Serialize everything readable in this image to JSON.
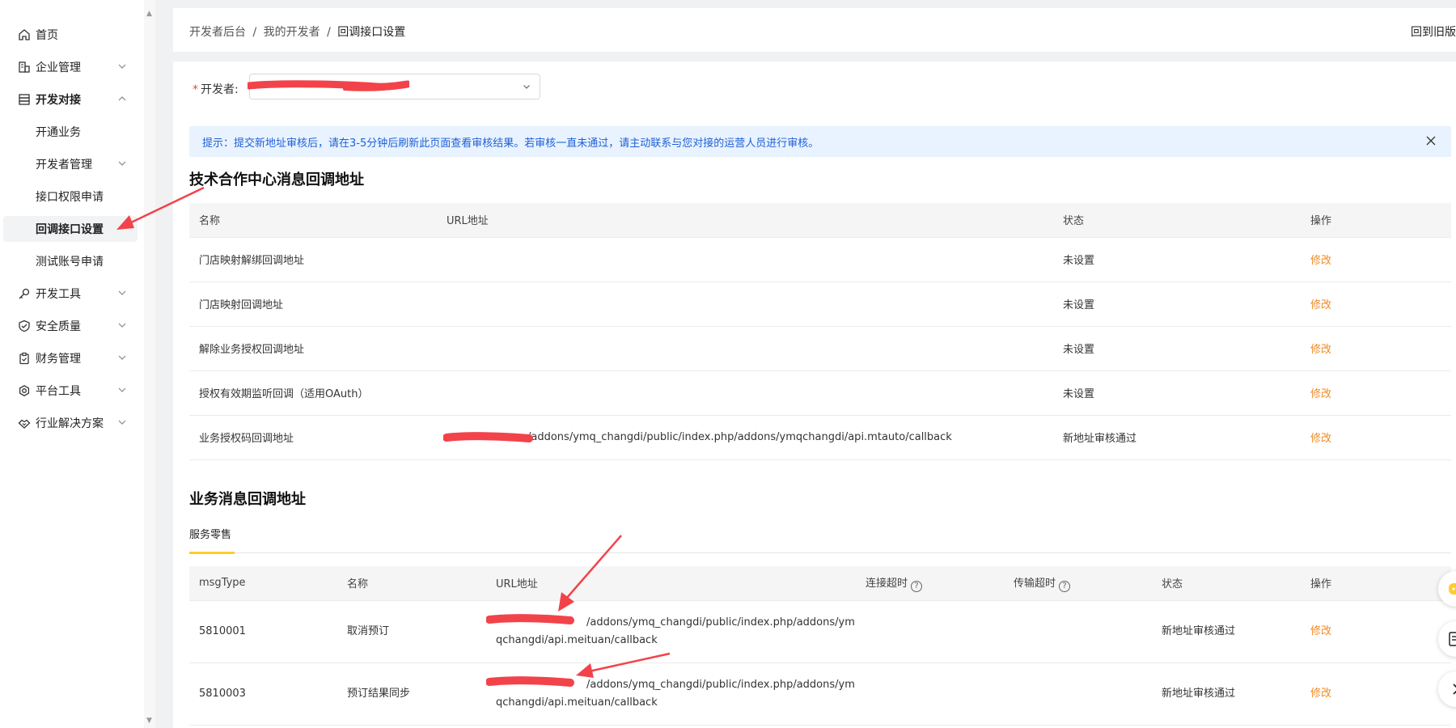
{
  "sidebar": {
    "items": [
      {
        "label": "首页",
        "icon": "home-icon"
      },
      {
        "label": "企业管理",
        "icon": "building-icon"
      },
      {
        "label": "开发对接",
        "icon": "database-icon"
      },
      {
        "label": "开通业务"
      },
      {
        "label": "开发者管理"
      },
      {
        "label": "接口权限申请"
      },
      {
        "label": "回调接口设置"
      },
      {
        "label": "测试账号申请"
      },
      {
        "label": "开发工具",
        "icon": "key-icon"
      },
      {
        "label": "安全质量",
        "icon": "shield-check-icon"
      },
      {
        "label": "财务管理",
        "icon": "clipboard-icon"
      },
      {
        "label": "平台工具",
        "icon": "gear-icon"
      },
      {
        "label": "行业解决方案",
        "icon": "handshake-icon"
      }
    ]
  },
  "breadcrumb": {
    "items": [
      "开发者后台",
      "我的开发者",
      "回调接口设置"
    ],
    "separator": "/"
  },
  "header": {
    "back_old": "回到旧版"
  },
  "developer": {
    "required_mark": "*",
    "label": "开发者:"
  },
  "tip": {
    "text": "提示：提交新地址审核后，请在3-5分钟后刷新此页面查看审核结果。若审核一直未通过，请主动联系与您对接的运营人员进行审核。"
  },
  "section1": {
    "title": "技术合作中心消息回调地址",
    "columns": [
      "名称",
      "URL地址",
      "状态",
      "操作"
    ],
    "rows": [
      {
        "name": "门店映射解绑回调地址",
        "url": "",
        "status": "未设置",
        "op": "修改"
      },
      {
        "name": "门店映射回调地址",
        "url": "",
        "status": "未设置",
        "op": "修改"
      },
      {
        "name": "解除业务授权回调地址",
        "url": "",
        "status": "未设置",
        "op": "修改"
      },
      {
        "name": "授权有效期监听回调（适用OAuth）",
        "url": "",
        "status": "未设置",
        "op": "修改"
      },
      {
        "name": "业务授权码回调地址",
        "url": "/addons/ymq_changdi/public/index.php/addons/ymqchangdi/api.mtauto/callback",
        "status": "新地址审核通过",
        "op": "修改"
      }
    ]
  },
  "section2": {
    "title": "业务消息回调地址",
    "tab": "服务零售",
    "columns": [
      "msgType",
      "名称",
      "URL地址",
      "连接超时",
      "传输超时",
      "状态",
      "操作"
    ],
    "help_glyph": "?",
    "rows": [
      {
        "msgType": "5810001",
        "name": "取消预订",
        "url_line1": "/addons/ymq_changdi/public/index.php/addons/ym",
        "url_line2": "qchangdi/api.meituan/callback",
        "status": "新地址审核通过",
        "op": "修改"
      },
      {
        "msgType": "5810003",
        "name": "预订结果同步",
        "url_line1": "/addons/ymq_changdi/public/index.php/addons/ym",
        "url_line2": "qchangdi/api.meituan/callback",
        "status": "新地址审核通过",
        "op": "修改"
      }
    ]
  },
  "colors": {
    "accent_orange": "#f08a24",
    "tip_bg": "#e8f3ff",
    "tip_text": "#1f5fd6",
    "tab_underline": "#ffcc2b",
    "annotation_red": "#f2434a"
  }
}
